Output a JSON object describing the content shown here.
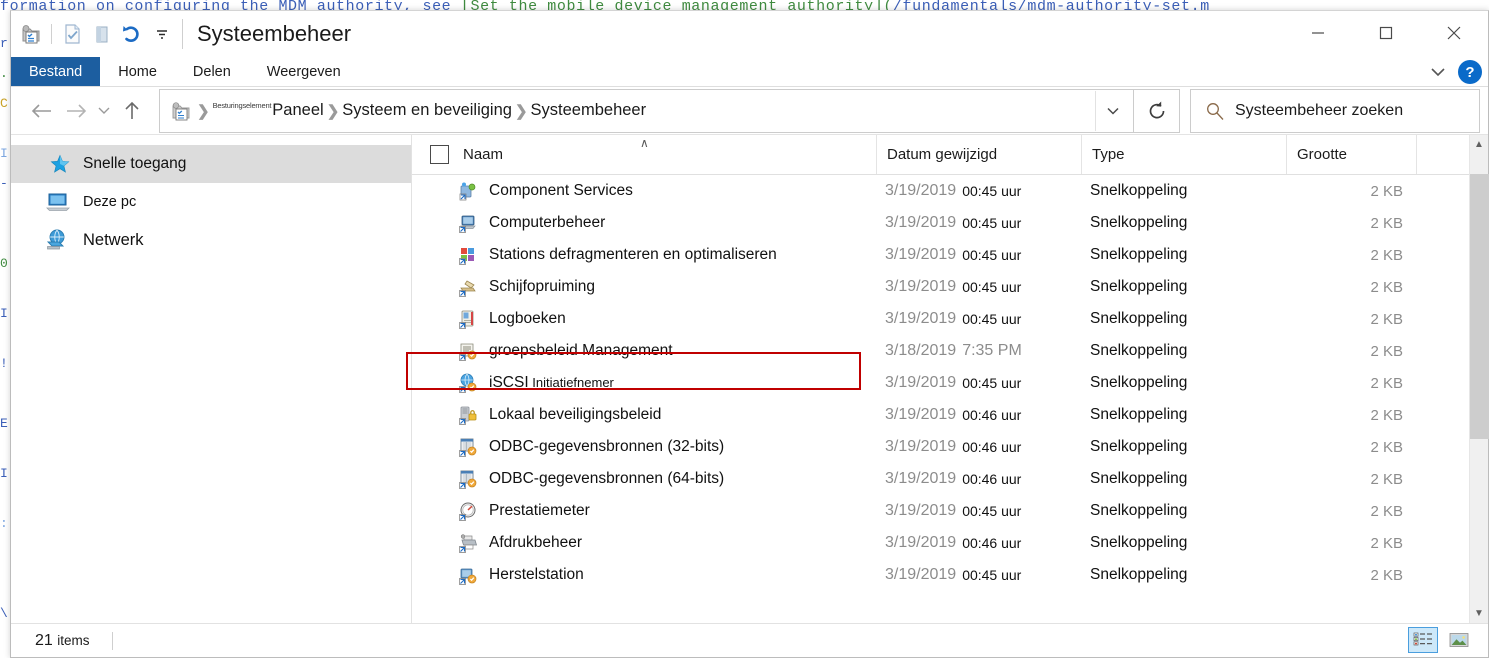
{
  "background": {
    "code_line_pre": "formation on configuring the MDM authority, see ",
    "code_line_link": "[Set the mobile device management authority](",
    "code_line_path": "/fundamentals/mdm-authority-set.m",
    "edge_fragments": [
      "r",
      ".(",
      "C",
      "I",
      "-",
      "0",
      "I!",
      "!",
      "E",
      "I",
      ":",
      "\\"
    ]
  },
  "titlebar": {
    "title": "Systeembeheer",
    "quick_access": [
      {
        "name": "folder-properties-icon",
        "label": "Eigenschappen"
      },
      {
        "name": "properties-icon",
        "label": "Eigenschappen"
      },
      {
        "name": "new-folder-icon",
        "label": "Nieuwe map"
      },
      {
        "name": "undo-icon",
        "label": "Ongedaan maken"
      },
      {
        "name": "customize-qat-dropdown-icon",
        "label": "Werkbalk Snelle toegang aanpassen"
      }
    ],
    "minimize_label": "Minimaliseren",
    "maximize_label": "Maximaliseren",
    "close_label": "Sluiten"
  },
  "ribbon": {
    "tabs": [
      {
        "label": "Bestand",
        "active": true
      },
      {
        "label": "Home",
        "active": false
      },
      {
        "label": "Delen",
        "active": false
      },
      {
        "label": "Weergeven",
        "active": false
      }
    ],
    "collapse_label": "Het lint minimaliseren",
    "help_label": "?"
  },
  "address": {
    "back_label": "Vorige",
    "forward_label": "Volgende",
    "recent_label": "Recente locaties",
    "up_label": "Omhoog",
    "breadcrumb": [
      {
        "tiny": "Besturingselement",
        "label": "Paneel"
      },
      {
        "tiny": "",
        "label": "Systeem en beveiliging"
      },
      {
        "tiny": "",
        "label": "Systeembeheer"
      }
    ],
    "dropdown_label": "Vorige locaties",
    "refresh_label": "Vernieuwen",
    "search_placeholder": "Systeembeheer zoeken"
  },
  "navpane": {
    "items": [
      {
        "label": "Snelle toegang",
        "icon": "star-icon",
        "selected": true
      },
      {
        "label": "Deze pc",
        "icon": "computer-icon",
        "selected": false
      },
      {
        "label": "Netwerk",
        "icon": "network-icon",
        "selected": false
      }
    ]
  },
  "columns": {
    "select_all_label": "Alles selecteren",
    "name": "Naam",
    "date": "Datum gewijzigd",
    "type": "Type",
    "size": "Grootte",
    "sort_caret": "∧"
  },
  "files": [
    {
      "name": "Component Services",
      "sub": "",
      "icon": "component-services-icon",
      "date": "3/19/2019",
      "time": "00:45 uur",
      "allgray": false,
      "type": "Snelkoppeling",
      "size": "2 KB"
    },
    {
      "name": "Computerbeheer",
      "sub": "",
      "icon": "computer-management-icon",
      "date": "3/19/2019",
      "time": "00:45 uur",
      "allgray": false,
      "type": "Snelkoppeling",
      "size": "2 KB"
    },
    {
      "name": "Stations defragmenteren en optimaliseren",
      "sub": "",
      "icon": "defrag-icon",
      "date": "3/19/2019",
      "time": "00:45 uur",
      "allgray": false,
      "type": "Snelkoppeling",
      "size": "2 KB"
    },
    {
      "name": "Schijfopruiming",
      "sub": "",
      "icon": "disk-cleanup-icon",
      "date": "3/19/2019",
      "time": "00:45 uur",
      "allgray": false,
      "type": "Snelkoppeling",
      "size": "2 KB"
    },
    {
      "name": "Logboeken",
      "sub": "",
      "icon": "event-viewer-icon",
      "date": "3/19/2019",
      "time": "00:45 uur",
      "allgray": false,
      "type": "Snelkoppeling",
      "size": "2 KB"
    },
    {
      "name": "groepsbeleid Management",
      "sub": "",
      "icon": "group-policy-icon",
      "date": "3/18/2019",
      "time": "7:35 PM",
      "allgray": true,
      "type": "Snelkoppeling",
      "size": "2 KB"
    },
    {
      "name": "iSCSI",
      "sub": " Initiatiefnemer",
      "icon": "iscsi-icon",
      "date": "3/19/2019",
      "time": "00:45 uur",
      "allgray": false,
      "type": "Snelkoppeling",
      "size": "2 KB"
    },
    {
      "name": "Lokaal beveiligingsbeleid",
      "sub": "",
      "icon": "local-security-policy-icon",
      "date": "3/19/2019",
      "time": "00:46 uur",
      "allgray": false,
      "type": "Snelkoppeling",
      "size": "2 KB"
    },
    {
      "name": "ODBC-gegevensbronnen (32-bits)",
      "sub": "",
      "icon": "odbc-icon",
      "date": "3/19/2019",
      "time": "00:46 uur",
      "allgray": false,
      "type": "Snelkoppeling",
      "size": "2 KB"
    },
    {
      "name": "ODBC-gegevensbronnen (64-bits)",
      "sub": "",
      "icon": "odbc-icon",
      "date": "3/19/2019",
      "time": "00:46 uur",
      "allgray": false,
      "type": "Snelkoppeling",
      "size": "2 KB"
    },
    {
      "name": "Prestatiemeter",
      "sub": "",
      "icon": "performance-monitor-icon",
      "date": "3/19/2019",
      "time": "00:45 uur",
      "allgray": false,
      "type": "Snelkoppeling",
      "size": "2 KB"
    },
    {
      "name": "Afdrukbeheer",
      "sub": "",
      "icon": "print-management-icon",
      "date": "3/19/2019",
      "time": "00:46 uur",
      "allgray": false,
      "type": "Snelkoppeling",
      "size": "2 KB"
    },
    {
      "name": "Herstelstation",
      "sub": "",
      "icon": "recovery-drive-icon",
      "date": "3/19/2019",
      "time": "00:45 uur",
      "allgray": false,
      "type": "Snelkoppeling",
      "size": "2 KB"
    }
  ],
  "highlight": {
    "row_index": 5,
    "color": "#c00000"
  },
  "statusbar": {
    "count": "21",
    "count_word": "items",
    "details_view_label": "Details",
    "large_icons_view_label": "Grote pictogrammen"
  }
}
